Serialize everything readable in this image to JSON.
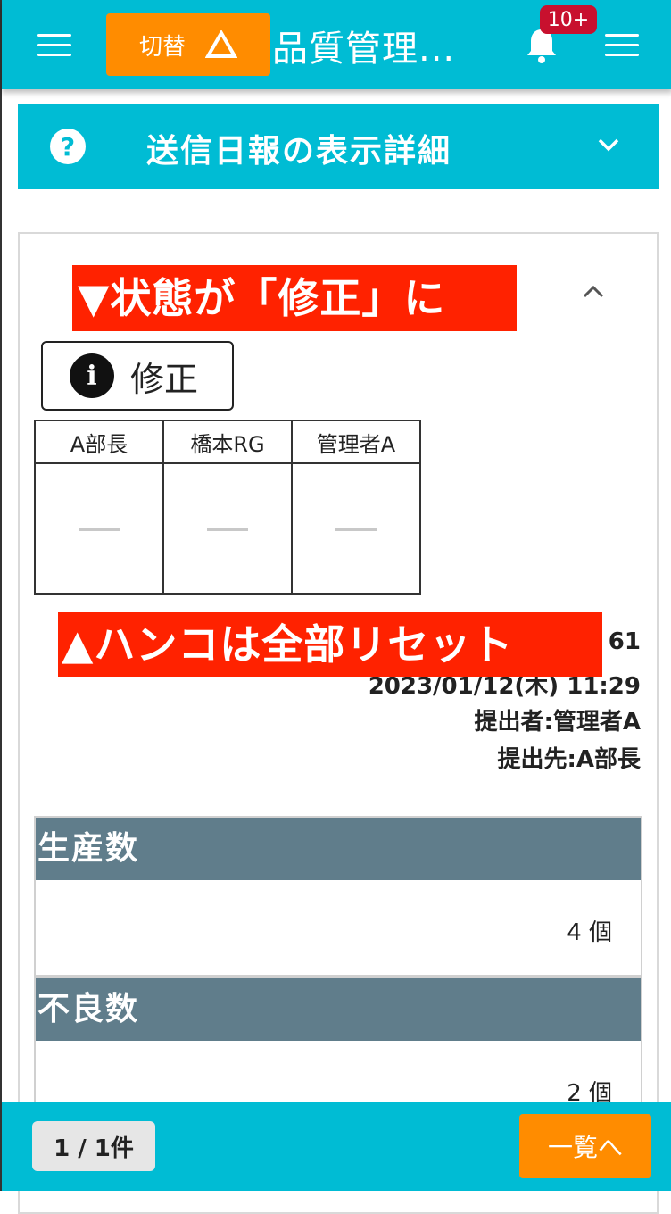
{
  "header": {
    "switch_label": "切替",
    "title": "品質管理...",
    "badge": "10+"
  },
  "accordion": {
    "title": "送信日報の表示詳細",
    "help_glyph": "?"
  },
  "annotations": {
    "top": "▼状態が「修正」に",
    "bottom": "▲ハンコは全部リセット"
  },
  "status": {
    "label": "修正",
    "icon_glyph": "i"
  },
  "stamps": {
    "headers": [
      "A部長",
      "橋本RG",
      "管理者A"
    ]
  },
  "meta": {
    "number_fragment": ": 61",
    "datetime": "2023/01/12(木) 11:29",
    "submitter": "提出者:管理者A",
    "destination": "提出先:A部長"
  },
  "sections": [
    {
      "title": "生産数",
      "value": "4 個"
    },
    {
      "title": "不良数",
      "value": "2 個"
    }
  ],
  "footer": {
    "page_count": "1 / 1件",
    "list_button": "一覧へ"
  },
  "colors": {
    "primary": "#00bcd4",
    "accent": "#ff8c00",
    "annotation": "#ff2200",
    "badge": "#c8102e",
    "section_header": "#607d8b"
  }
}
